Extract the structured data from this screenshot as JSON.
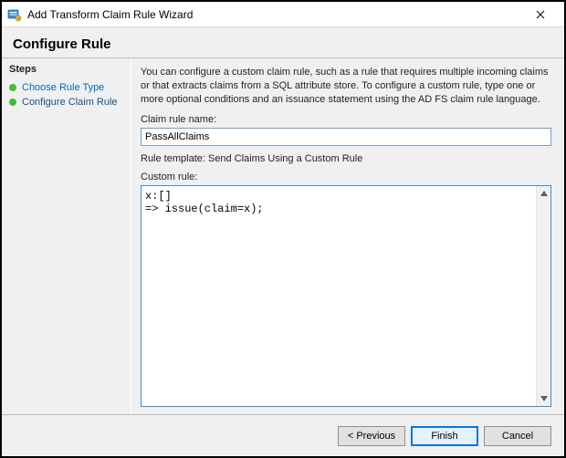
{
  "window": {
    "title": "Add Transform Claim Rule Wizard"
  },
  "heading": "Configure Rule",
  "steps": {
    "title": "Steps",
    "items": [
      {
        "label": "Choose Rule Type"
      },
      {
        "label": "Configure Claim Rule"
      }
    ]
  },
  "main": {
    "description": "You can configure a custom claim rule, such as a rule that requires multiple incoming claims or that extracts claims from a SQL attribute store. To configure a custom rule, type one or more optional conditions and an issuance statement using the AD FS claim rule language.",
    "claim_rule_name_label": "Claim rule name:",
    "claim_rule_name_value": "PassAllClaims",
    "rule_template_label": "Rule template: Send Claims Using a Custom Rule",
    "custom_rule_label": "Custom rule:",
    "custom_rule_value": "x:[]\n=> issue(claim=x);"
  },
  "footer": {
    "previous": "< Previous",
    "finish": "Finish",
    "cancel": "Cancel"
  }
}
